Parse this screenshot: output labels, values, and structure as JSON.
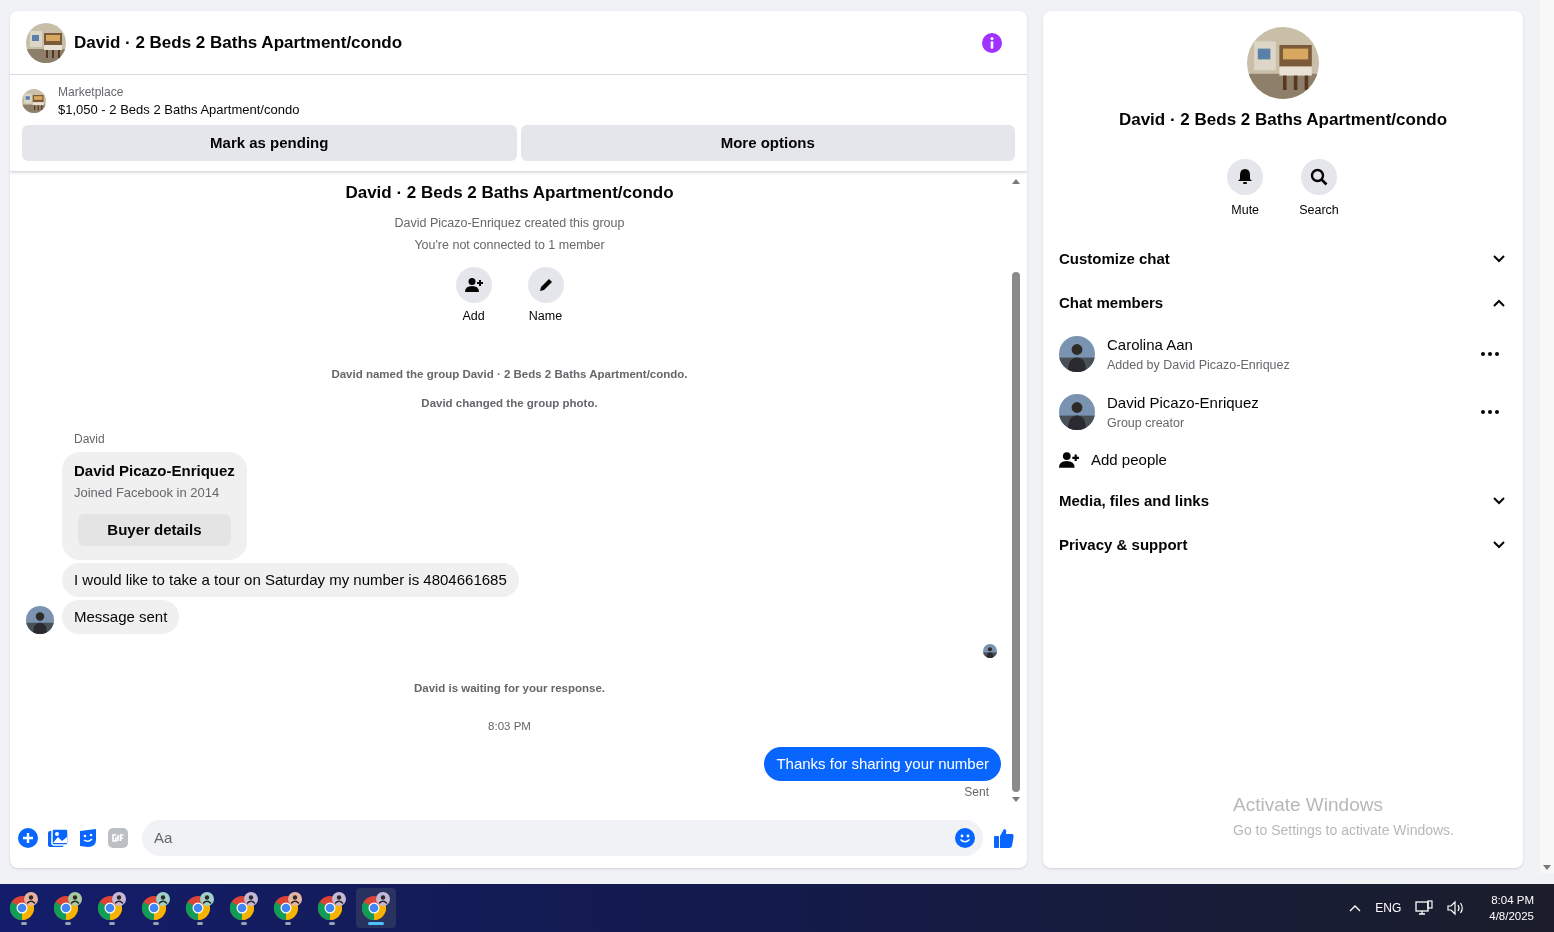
{
  "header": {
    "title": "David · 2 Beds 2 Baths Apartment/condo"
  },
  "listing": {
    "source": "Marketplace",
    "title": "$1,050 - 2 Beds 2 Baths Apartment/condo",
    "actions": [
      "Mark as pending",
      "More options"
    ]
  },
  "conversation": {
    "title": "David · 2 Beds 2 Baths Apartment/condo",
    "info": [
      "David Picazo-Enriquez created this group",
      "You're not connected to 1 member"
    ],
    "actions": [
      {
        "label": "Add",
        "kind": "add"
      },
      {
        "label": "Name",
        "kind": "name"
      }
    ],
    "events": [
      "David named the group David · 2 Beds 2 Baths Apartment/condo.",
      "David changed the group photo."
    ],
    "sender": "David",
    "profile_card": {
      "name": "David Picazo-Enriquez",
      "subtitle": "Joined Facebook in 2014",
      "button": "Buyer details"
    },
    "messages": [
      {
        "text": "I would like to take a tour on Saturday my number is 4804661685",
        "show_avatar": false
      },
      {
        "text": "Message sent",
        "show_avatar": true
      }
    ],
    "waiting": "David is waiting for your response.",
    "time": "8:03 PM",
    "outgoing": {
      "text": "Thanks for sharing your number",
      "status": "Sent"
    }
  },
  "composer": {
    "placeholder": "Aa"
  },
  "details": {
    "title": "David · 2 Beds 2 Baths Apartment/condo",
    "actions": [
      {
        "label": "Mute",
        "kind": "mute"
      },
      {
        "label": "Search",
        "kind": "search"
      }
    ],
    "sections": [
      {
        "kind": "section",
        "label": "Customize chat",
        "expanded": false
      },
      {
        "kind": "members",
        "label": "Chat members",
        "expanded": true,
        "members": [
          {
            "name": "Carolina Aan",
            "subtitle": "Added by David Picazo-Enriquez"
          },
          {
            "name": "David Picazo-Enriquez",
            "subtitle": "Group creator"
          }
        ],
        "add_label": "Add people"
      },
      {
        "kind": "section",
        "label": "Media, files and links",
        "expanded": false
      },
      {
        "kind": "section",
        "label": "Privacy & support",
        "expanded": false
      }
    ]
  },
  "activation": {
    "title": "Activate Windows",
    "subtitle": "Go to Settings to activate Windows."
  },
  "taskbar": {
    "apps": [
      {
        "selected": false,
        "color": "#e8b4a0"
      },
      {
        "selected": false,
        "color": "#a8c8a0"
      },
      {
        "selected": false,
        "color": "#c8b8d8"
      },
      {
        "selected": false,
        "color": "#a0d0c8"
      },
      {
        "selected": false,
        "color": "#a0d0c8"
      },
      {
        "selected": false,
        "color": "#c8b8d8"
      },
      {
        "selected": false,
        "color": "#e8b4a0"
      },
      {
        "selected": false,
        "color": "#c8b8d8"
      },
      {
        "selected": true,
        "color": "#c8b8d8"
      }
    ],
    "language": "ENG",
    "time": "8:04 PM",
    "date": "4/8/2025"
  }
}
